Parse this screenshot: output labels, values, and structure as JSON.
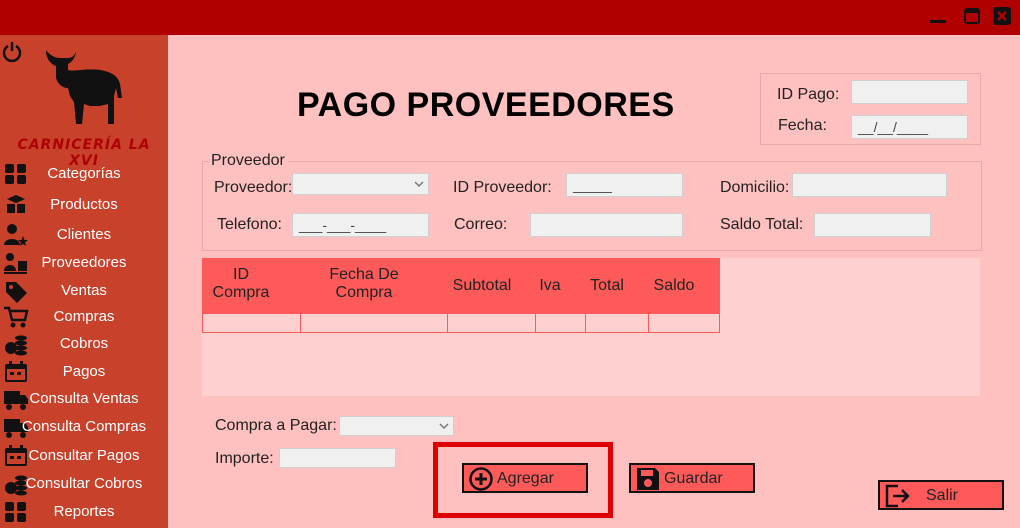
{
  "window": {
    "title_bar_color": "#b00000"
  },
  "sidebar": {
    "brand": "CARNICERÍA LA XVI",
    "items": [
      {
        "label": "Categorías",
        "icon": "grid-icon"
      },
      {
        "label": "Productos",
        "icon": "boxes-icon"
      },
      {
        "label": "Clientes",
        "icon": "user-star-icon"
      },
      {
        "label": "Proveedores",
        "icon": "supplier-icon"
      },
      {
        "label": "Ventas",
        "icon": "tag-icon"
      },
      {
        "label": "Compras",
        "icon": "cart-icon"
      },
      {
        "label": "Cobros",
        "icon": "coins-icon"
      },
      {
        "label": "Pagos",
        "icon": "calendar-money-icon"
      },
      {
        "label": "Consulta Ventas",
        "icon": "truck-icon"
      },
      {
        "label": "Consulta Compras",
        "icon": "truck-icon"
      },
      {
        "label": "Consultar Pagos",
        "icon": "calendar-money-icon"
      },
      {
        "label": "Consultar Cobros",
        "icon": "coins-icon"
      },
      {
        "label": "Reportes",
        "icon": "grid-icon"
      }
    ]
  },
  "page": {
    "title": "PAGO PROVEEDORES"
  },
  "header_box": {
    "id_pago_label": "ID Pago:",
    "id_pago_value": "",
    "fecha_label": "Fecha:",
    "fecha_value": "__/__/____"
  },
  "proveedor_group": {
    "legend": "Proveedor",
    "proveedor_label": "Proveedor:",
    "proveedor_value": "",
    "id_proveedor_label": "ID Proveedor:",
    "id_proveedor_value": "_____",
    "domicilio_label": "Domicilio:",
    "domicilio_value": "",
    "telefono_label": "Telefono:",
    "telefono_value": "___-___-____",
    "correo_label": "Correo:",
    "correo_value": "",
    "saldo_total_label": "Saldo Total:",
    "saldo_total_value": ""
  },
  "table": {
    "columns": [
      "ID\nCompra",
      "Fecha De\nCompra",
      "Subtotal",
      "Iva",
      "Total",
      "Saldo"
    ],
    "rows": [
      [
        "",
        "",
        "",
        "",
        "",
        ""
      ]
    ]
  },
  "payment": {
    "compra_label": "Compra a Pagar:",
    "compra_value": "",
    "importe_label": "Importe:",
    "importe_value": ""
  },
  "buttons": {
    "agregar": "Agregar",
    "guardar": "Guardar",
    "salir": "Salir"
  },
  "colors": {
    "sidebar": "#c8412a",
    "background": "#ffc0c0",
    "accent": "#ff5a5a",
    "highlight": "#e00000"
  }
}
